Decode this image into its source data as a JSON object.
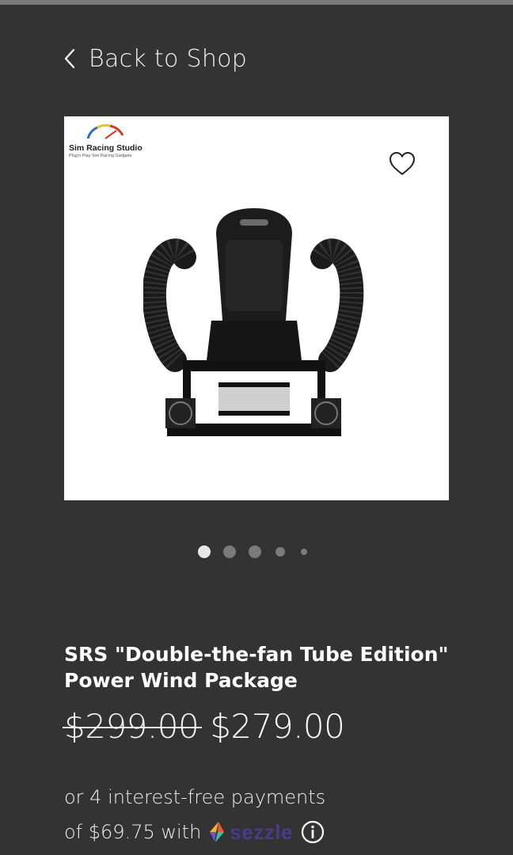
{
  "nav": {
    "back_label": "Back to Shop"
  },
  "gallery": {
    "brand_name": "Sim Racing Studio",
    "brand_tagline": "Plug'n Play Sim Racing Gadgets",
    "slide_count": 5,
    "active_slide": 0
  },
  "product": {
    "title_line1": "SRS \"Double-the-fan Tube Edition\"",
    "title_line2": "Power Wind Package",
    "original_price": "$299.00",
    "sale_price": "$279.00"
  },
  "financing": {
    "line1": "or 4 interest-free payments",
    "line2": "of $69.75 with",
    "provider": "sezzle"
  },
  "icons": {
    "back": "chevron-left-icon",
    "favorite": "heart-outline-icon",
    "info": "info-circle-icon"
  },
  "colors": {
    "background": "#333333",
    "text": "#ffffff",
    "dot_active": "#e8e8e8",
    "dot_inactive": "#7b7b7b",
    "sezzle_purple": "#4b3a8c"
  }
}
